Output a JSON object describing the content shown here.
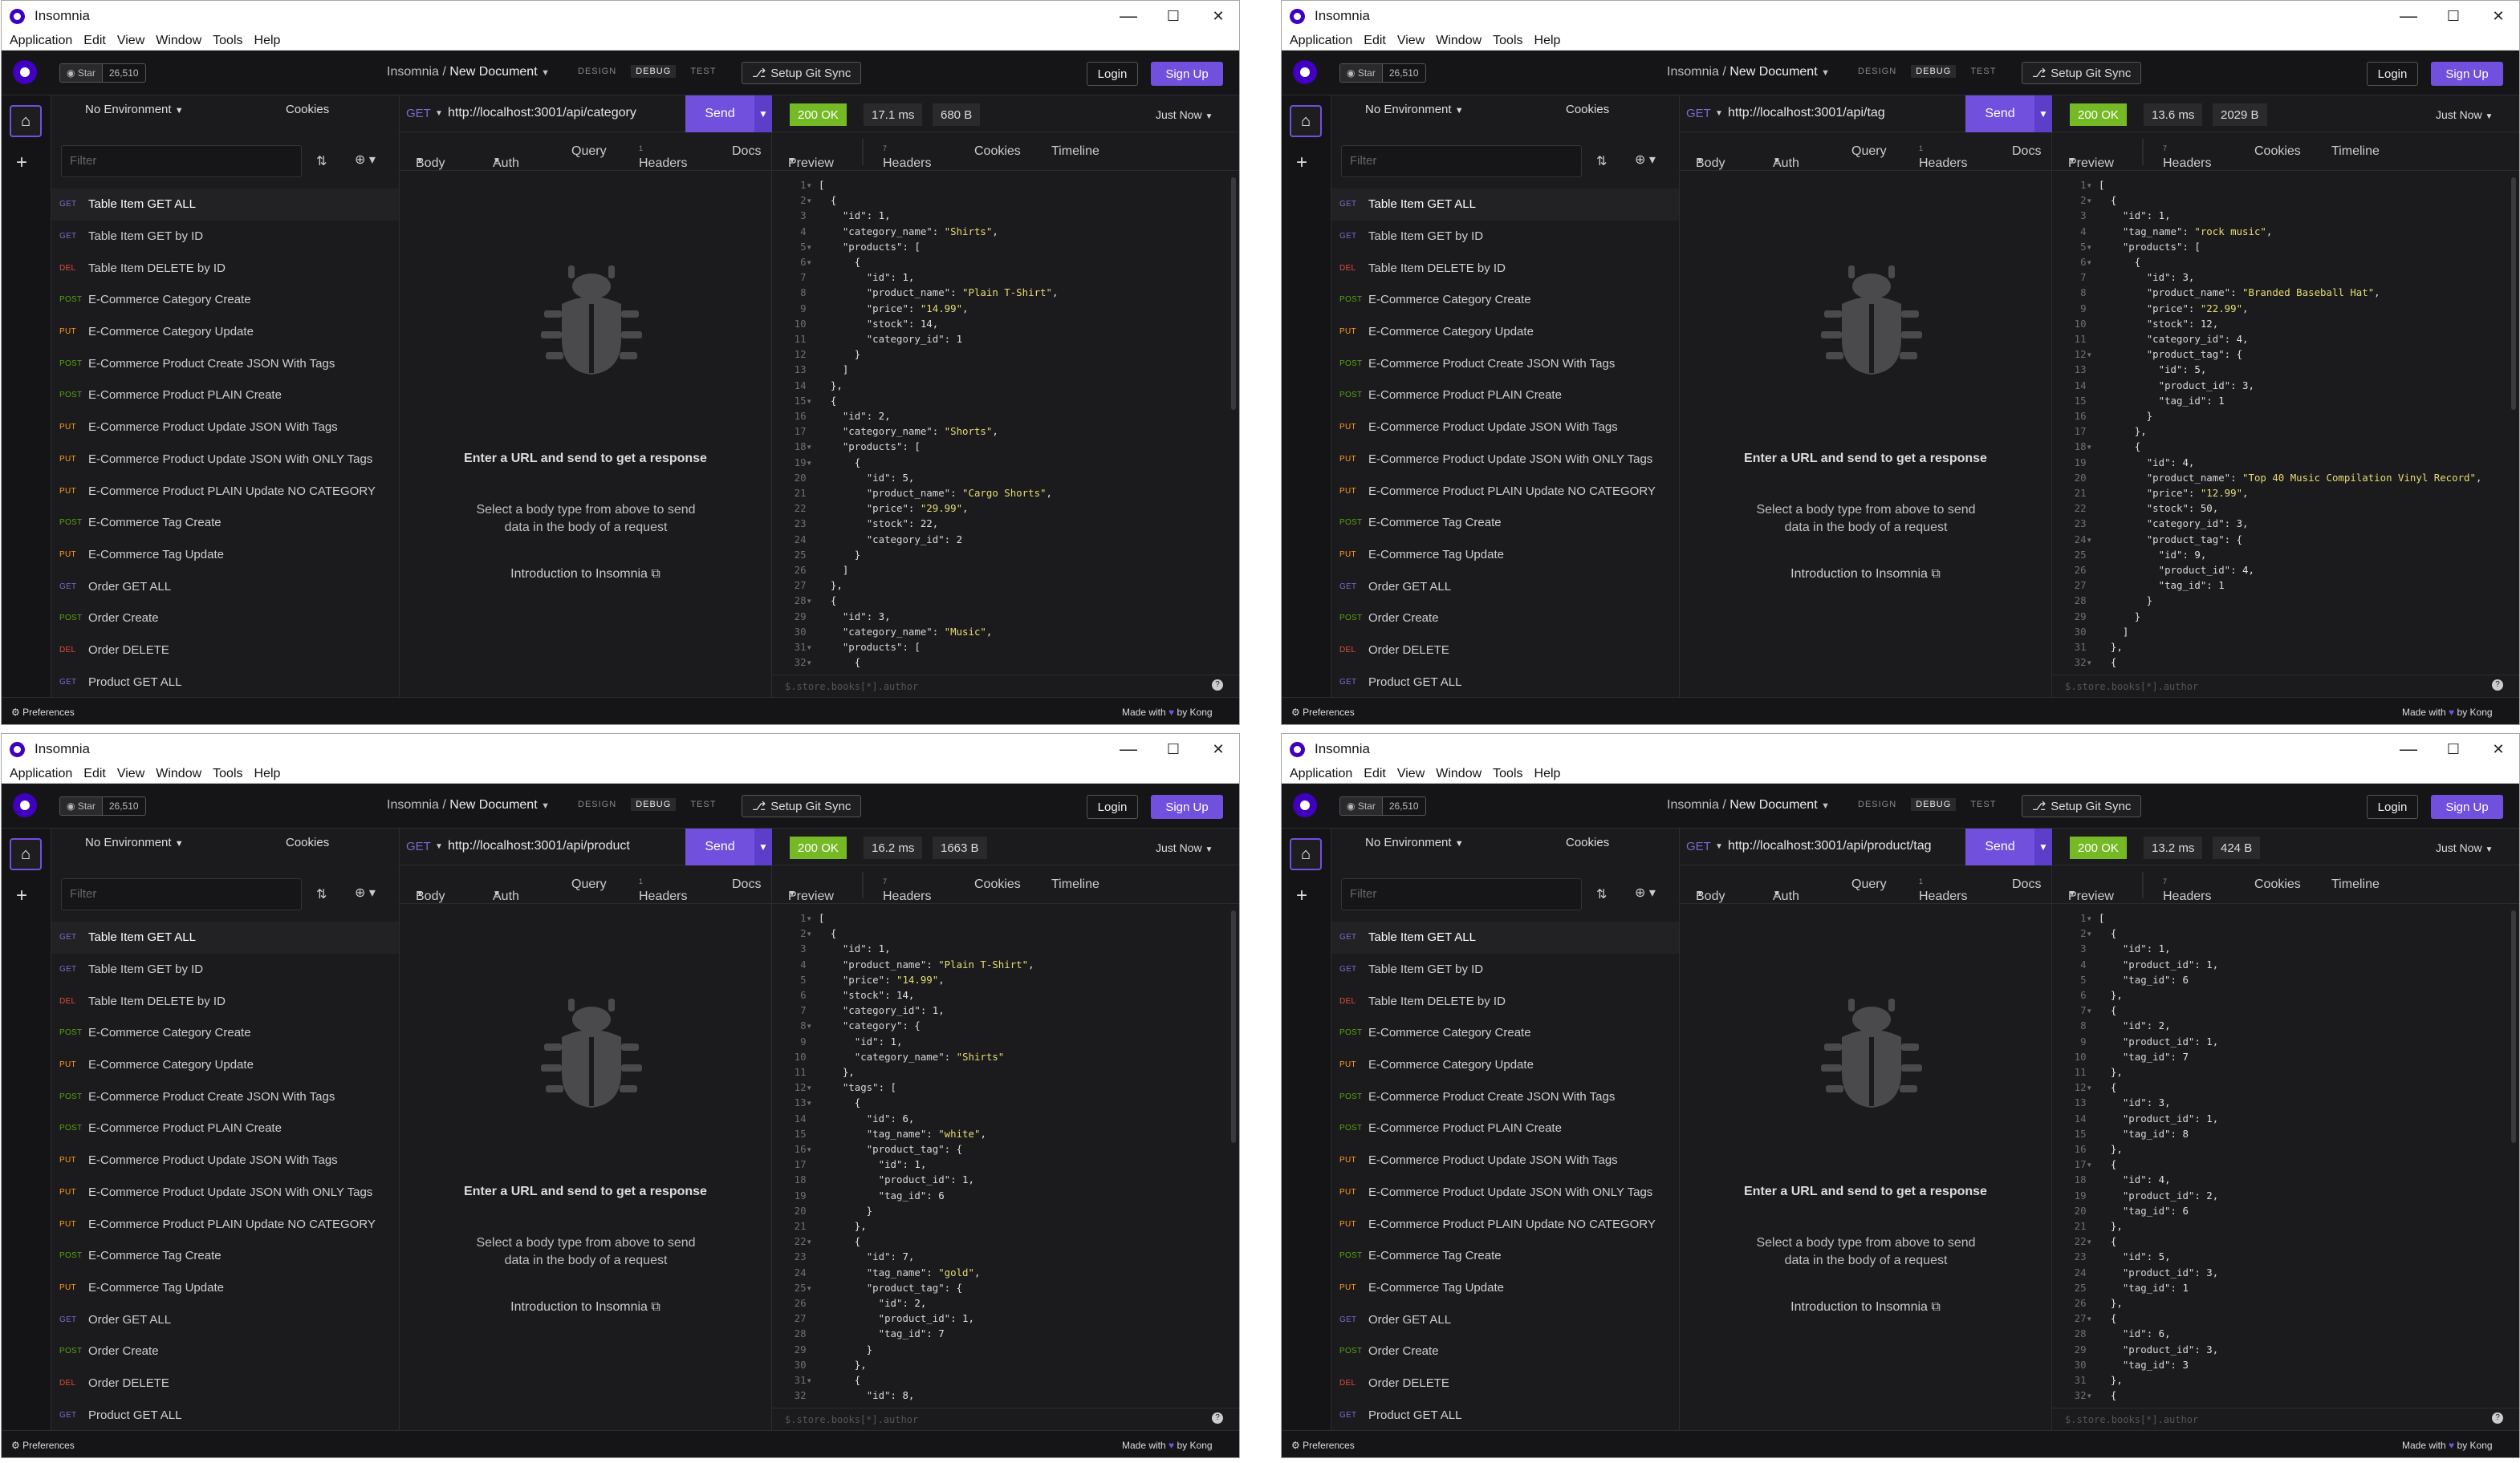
{
  "app_title": "Insomnia",
  "menu": [
    "Application",
    "Edit",
    "View",
    "Window",
    "Tools",
    "Help"
  ],
  "window_controls": {
    "minimize": "—",
    "maximize": "☐",
    "close": "✕"
  },
  "star": {
    "label": "Star",
    "count": "26,510"
  },
  "breadcrumb": {
    "root": "Insomnia",
    "sep": " / ",
    "doc": "New Document"
  },
  "modes": [
    "DESIGN",
    "DEBUG",
    "TEST"
  ],
  "git_sync": "Setup Git Sync",
  "login": "Login",
  "signup": "Sign Up",
  "environment": "No Environment",
  "cookies": "Cookies",
  "filter_placeholder": "Filter",
  "requests": [
    {
      "method": "GET",
      "label": "Table Item GET ALL"
    },
    {
      "method": "GET",
      "label": "Table Item GET by ID"
    },
    {
      "method": "DEL",
      "label": "Table Item DELETE by ID"
    },
    {
      "method": "POST",
      "label": "E-Commerce Category Create"
    },
    {
      "method": "PUT",
      "label": "E-Commerce Category Update"
    },
    {
      "method": "POST",
      "label": "E-Commerce Product Create JSON With Tags"
    },
    {
      "method": "POST",
      "label": "E-Commerce Product PLAIN Create"
    },
    {
      "method": "PUT",
      "label": "E-Commerce Product Update JSON With Tags"
    },
    {
      "method": "PUT",
      "label": "E-Commerce Product Update JSON With ONLY Tags"
    },
    {
      "method": "PUT",
      "label": "E-Commerce Product PLAIN Update NO CATEGORY"
    },
    {
      "method": "POST",
      "label": "E-Commerce Tag Create"
    },
    {
      "method": "PUT",
      "label": "E-Commerce Tag Update"
    },
    {
      "method": "GET",
      "label": "Order GET ALL"
    },
    {
      "method": "POST",
      "label": "Order Create"
    },
    {
      "method": "DEL",
      "label": "Order DELETE"
    },
    {
      "method": "GET",
      "label": "Product GET ALL"
    }
  ],
  "request_method": "GET",
  "send": "Send",
  "req_tabs": {
    "body": "Body",
    "auth": "Auth",
    "query": "Query",
    "headers": "Headers",
    "headers_count": "1",
    "docs": "Docs"
  },
  "empty": {
    "title": "Enter a URL and send to get a response",
    "subtitle": "Select a body type from above to send data in the body of a request",
    "intro": "Introduction to Insomnia"
  },
  "resp_tabs": {
    "preview": "Preview",
    "headers": "Headers",
    "headers_count": "7",
    "cookies": "Cookies",
    "timeline": "Timeline"
  },
  "json_path_placeholder": "$.store.books[*].author",
  "preferences": "Preferences",
  "made_with": {
    "pre": "Made with",
    "post": "by Kong"
  },
  "colors": {
    "accent": "#7250de",
    "ok": "#75ba24",
    "get": "#7d69cb",
    "post": "#59a210",
    "put": "#ff9a1f",
    "del": "#e14c3c",
    "string": "#e7db74"
  },
  "windows": [
    {
      "url": "http://localhost:3001/api/category",
      "status": "200 OK",
      "time": "17.1 ms",
      "size": "680 B",
      "when": "Just Now",
      "code": [
        "[",
        "  {",
        "    \"id\": 1,",
        "    \"category_name\": \"Shirts\",",
        "    \"products\": [",
        "      {",
        "        \"id\": 1,",
        "        \"product_name\": \"Plain T-Shirt\",",
        "        \"price\": \"14.99\",",
        "        \"stock\": 14,",
        "        \"category_id\": 1",
        "      }",
        "    ]",
        "  },",
        "  {",
        "    \"id\": 2,",
        "    \"category_name\": \"Shorts\",",
        "    \"products\": [",
        "      {",
        "        \"id\": 5,",
        "        \"product_name\": \"Cargo Shorts\",",
        "        \"price\": \"29.99\",",
        "        \"stock\": 22,",
        "        \"category_id\": 2",
        "      }",
        "    ]",
        "  },",
        "  {",
        "    \"id\": 3,",
        "    \"category_name\": \"Music\",",
        "    \"products\": [",
        "      {"
      ]
    },
    {
      "url": "http://localhost:3001/api/tag",
      "status": "200 OK",
      "time": "13.6 ms",
      "size": "2029 B",
      "when": "Just Now",
      "code": [
        "[",
        "  {",
        "    \"id\": 1,",
        "    \"tag_name\": \"rock music\",",
        "    \"products\": [",
        "      {",
        "        \"id\": 3,",
        "        \"product_name\": \"Branded Baseball Hat\",",
        "        \"price\": \"22.99\",",
        "        \"stock\": 12,",
        "        \"category_id\": 4,",
        "        \"product_tag\": {",
        "          \"id\": 5,",
        "          \"product_id\": 3,",
        "          \"tag_id\": 1",
        "        }",
        "      },",
        "      {",
        "        \"id\": 4,",
        "        \"product_name\": \"Top 40 Music Compilation Vinyl Record\",",
        "        \"price\": \"12.99\",",
        "        \"stock\": 50,",
        "        \"category_id\": 3,",
        "        \"product_tag\": {",
        "          \"id\": 9,",
        "          \"product_id\": 4,",
        "          \"tag_id\": 1",
        "        }",
        "      }",
        "    ]",
        "  },",
        "  {"
      ]
    },
    {
      "url": "http://localhost:3001/api/product",
      "status": "200 OK",
      "time": "16.2 ms",
      "size": "1663 B",
      "when": "Just Now",
      "code": [
        "[",
        "  {",
        "    \"id\": 1,",
        "    \"product_name\": \"Plain T-Shirt\",",
        "    \"price\": \"14.99\",",
        "    \"stock\": 14,",
        "    \"category_id\": 1,",
        "    \"category\": {",
        "      \"id\": 1,",
        "      \"category_name\": \"Shirts\"",
        "    },",
        "    \"tags\": [",
        "      {",
        "        \"id\": 6,",
        "        \"tag_name\": \"white\",",
        "        \"product_tag\": {",
        "          \"id\": 1,",
        "          \"product_id\": 1,",
        "          \"tag_id\": 6",
        "        }",
        "      },",
        "      {",
        "        \"id\": 7,",
        "        \"tag_name\": \"gold\",",
        "        \"product_tag\": {",
        "          \"id\": 2,",
        "          \"product_id\": 1,",
        "          \"tag_id\": 7",
        "        }",
        "      },",
        "      {",
        "        \"id\": 8,"
      ]
    },
    {
      "url": "http://localhost:3001/api/product/tag",
      "status": "200 OK",
      "time": "13.2 ms",
      "size": "424 B",
      "when": "Just Now",
      "code": [
        "[",
        "  {",
        "    \"id\": 1,",
        "    \"product_id\": 1,",
        "    \"tag_id\": 6",
        "  },",
        "  {",
        "    \"id\": 2,",
        "    \"product_id\": 1,",
        "    \"tag_id\": 7",
        "  },",
        "  {",
        "    \"id\": 3,",
        "    \"product_id\": 1,",
        "    \"tag_id\": 8",
        "  },",
        "  {",
        "    \"id\": 4,",
        "    \"product_id\": 2,",
        "    \"tag_id\": 6",
        "  },",
        "  {",
        "    \"id\": 5,",
        "    \"product_id\": 3,",
        "    \"tag_id\": 1",
        "  },",
        "  {",
        "    \"id\": 6,",
        "    \"product_id\": 3,",
        "    \"tag_id\": 3",
        "  },",
        "  {"
      ]
    }
  ]
}
